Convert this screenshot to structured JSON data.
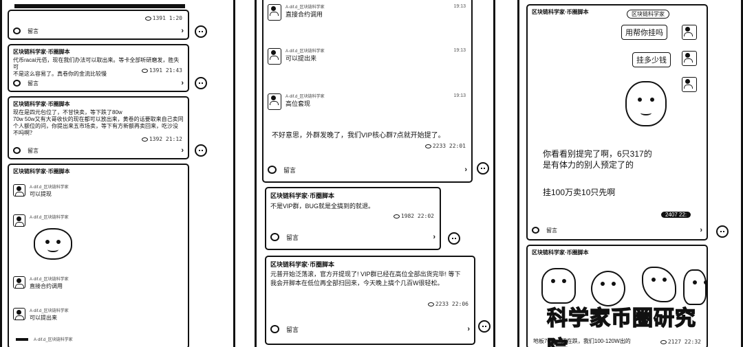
{
  "panel1": {
    "card0": {
      "views": "1391",
      "date": "1:20",
      "comment": "留言"
    },
    "card1": {
      "title": "区块链科学家·币圈脚本",
      "text1": "代币racai元佰，现在我们办法可以取出来。等卡全部听研磨发，胜失可",
      "text2": "不是这么容易了。真卷你的金流比较慢",
      "views": "1391",
      "date": "21:43",
      "comment": "留言"
    },
    "card2": {
      "title": "区块链科学家·币圈脚本",
      "text1": "现在是四元包位了，不甘快卖，等下跌了80w",
      "text2": "70w 50w又有大哥收伙的现在都可以放出来，黄卷的话要取来自己卖同",
      "text3": "个人额位的问，你提出来五市场卖，等下有方新额再卖回来，吃沙没",
      "text4": "不吗啊？",
      "views": "1392",
      "date": "21:12",
      "comment": "留言"
    },
    "card3": {
      "title": "区块链科学家·币圈脚本",
      "messages": [
        {
          "name": "A·dif.d_区块链科学家",
          "text": "可以提现"
        },
        {
          "name": "A·dif.d_区块链科学家",
          "text": ""
        },
        {
          "name": "A·dif.d_区块链科学家",
          "text": "直接合约调用"
        },
        {
          "name": "A·dif.d_区块链科学家",
          "text": "可以提出来"
        },
        {
          "name": "A·dif.d_区块链科学家",
          "text": ""
        }
      ]
    }
  },
  "panel2": {
    "card1": {
      "messages": [
        {
          "name": "A·dif.d_区块链科学家",
          "text": "直接合约调用",
          "time": "19:13"
        },
        {
          "name": "A·dif.d_区块链科学家",
          "text": "可以提出来",
          "time": "19:13"
        },
        {
          "name": "A·dif.d_区块链科学家",
          "text": "高位套现",
          "time": "19:13"
        }
      ],
      "post": "不好意思，外群发晚了，我们VIP核心群7点就开始提了。",
      "views": "2233",
      "date": "22:01",
      "comment": "留言"
    },
    "card2": {
      "title": "区块链科学家·币圈脚本",
      "text": "不是VIP群，BUG就是全搞到的就退。",
      "views": "1982",
      "date": "22:02",
      "comment": "留言"
    },
    "card3": {
      "title": "区块链科学家·币圈脚本",
      "text1": "元普开始泛荡滚，官方开提现了! VIP群已经在高位全部出货完毕! 等下",
      "text2": "我会开脚本在低位再全部扫回来，今天晚上搞个几百W很轻松。",
      "views": "2233",
      "date": "22:06",
      "comment": "留言"
    }
  },
  "panel3": {
    "card1": {
      "title": "区块链科学家·币圈脚本",
      "tag": "区块链科学家",
      "bubble1": "用帮你挂吗",
      "bubble2": "挂多少钱",
      "line1": "你看看别提完了啊，6只317的",
      "line2": "是有体力的别人预定了的",
      "line3": "挂100万卖10只先啊",
      "views": "2407",
      "date": "22:",
      "comment": "留言"
    },
    "card2": {
      "title": "区块链科学家·币圈脚本",
      "watermark": "科学家币圈研究院",
      "text": "地板70块，还在跌，我们100-120W出的",
      "views": "2127",
      "date": "22:32"
    }
  }
}
